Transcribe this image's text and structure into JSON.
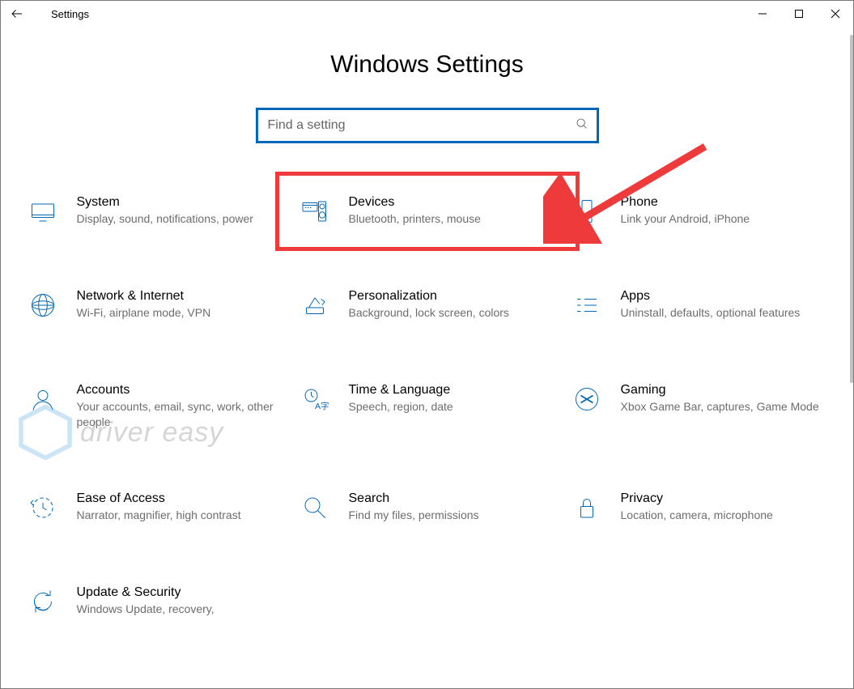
{
  "window_title": "Settings",
  "page_title": "Windows Settings",
  "search": {
    "placeholder": "Find a setting"
  },
  "tiles": [
    {
      "id": "system",
      "title": "System",
      "desc": "Display, sound, notifications, power"
    },
    {
      "id": "devices",
      "title": "Devices",
      "desc": "Bluetooth, printers, mouse",
      "highlight": true
    },
    {
      "id": "phone",
      "title": "Phone",
      "desc": "Link your Android, iPhone"
    },
    {
      "id": "network",
      "title": "Network & Internet",
      "desc": "Wi-Fi, airplane mode, VPN"
    },
    {
      "id": "personalization",
      "title": "Personalization",
      "desc": "Background, lock screen, colors"
    },
    {
      "id": "apps",
      "title": "Apps",
      "desc": "Uninstall, defaults, optional features"
    },
    {
      "id": "accounts",
      "title": "Accounts",
      "desc": "Your accounts, email, sync, work, other people"
    },
    {
      "id": "time",
      "title": "Time & Language",
      "desc": "Speech, region, date"
    },
    {
      "id": "gaming",
      "title": "Gaming",
      "desc": "Xbox Game Bar, captures, Game Mode"
    },
    {
      "id": "ease",
      "title": "Ease of Access",
      "desc": "Narrator, magnifier, high contrast"
    },
    {
      "id": "search",
      "title": "Search",
      "desc": "Find my files, permissions"
    },
    {
      "id": "privacy",
      "title": "Privacy",
      "desc": "Location, camera, microphone"
    },
    {
      "id": "update",
      "title": "Update & Security",
      "desc": "Windows Update, recovery,"
    }
  ],
  "watermark_text": "driver easy",
  "annotation": {
    "type": "arrow",
    "target": "devices",
    "color": "#ee3a3a"
  }
}
